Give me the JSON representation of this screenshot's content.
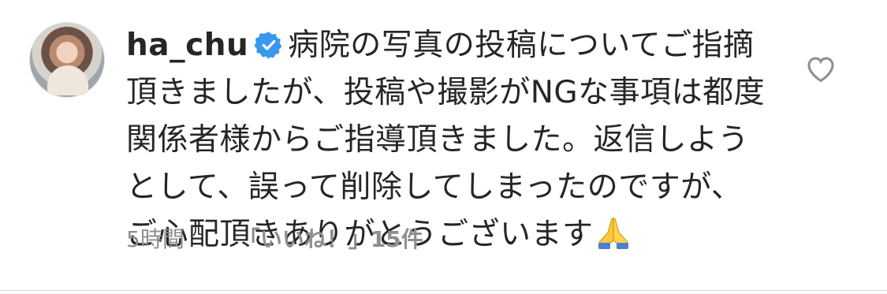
{
  "comment": {
    "username": "ha_chu",
    "verified": true,
    "text": "病院の写真の投稿についてご指摘頂きましたが、投稿や撮影がNGな事項は都度関係者様からご指導頂きました。返信しようとして、誤って削除してしまったのですが、ご心配頂きありがとうございます",
    "emoji": "pray-icon",
    "time": "5時間",
    "likes": "「いいね！」15件"
  },
  "colors": {
    "text": "#262626",
    "meta": "#8e8e8e",
    "verified": "#3897f0",
    "divider": "#dbdbdb"
  }
}
